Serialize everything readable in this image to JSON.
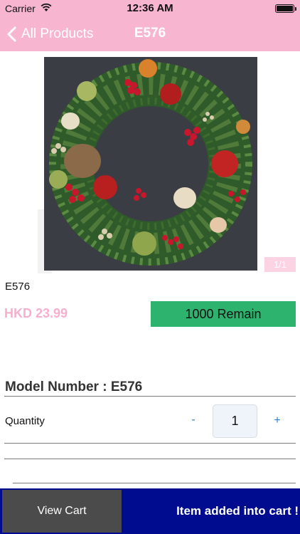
{
  "status_bar": {
    "carrier": "Carrier",
    "time": "12:36 AM"
  },
  "nav": {
    "back_label": "All Products",
    "title": "E576"
  },
  "product": {
    "pager": "1/1",
    "code": "E576",
    "price": "HKD 23.99",
    "remain": "1000 Remain",
    "model_number": "Model Number : E576"
  },
  "quantity": {
    "label": "Quantity",
    "minus": "-",
    "value": "1",
    "plus": "+"
  },
  "bottom_bar": {
    "view_cart": "View Cart",
    "message": "Item added into cart !"
  },
  "colors": {
    "nav_bg": "#f8b5d0",
    "price": "#f7b0cc",
    "remain_bg": "#2db36e",
    "bottom_bg": "#000c8f",
    "view_cart_bg": "#4b4b4b"
  }
}
